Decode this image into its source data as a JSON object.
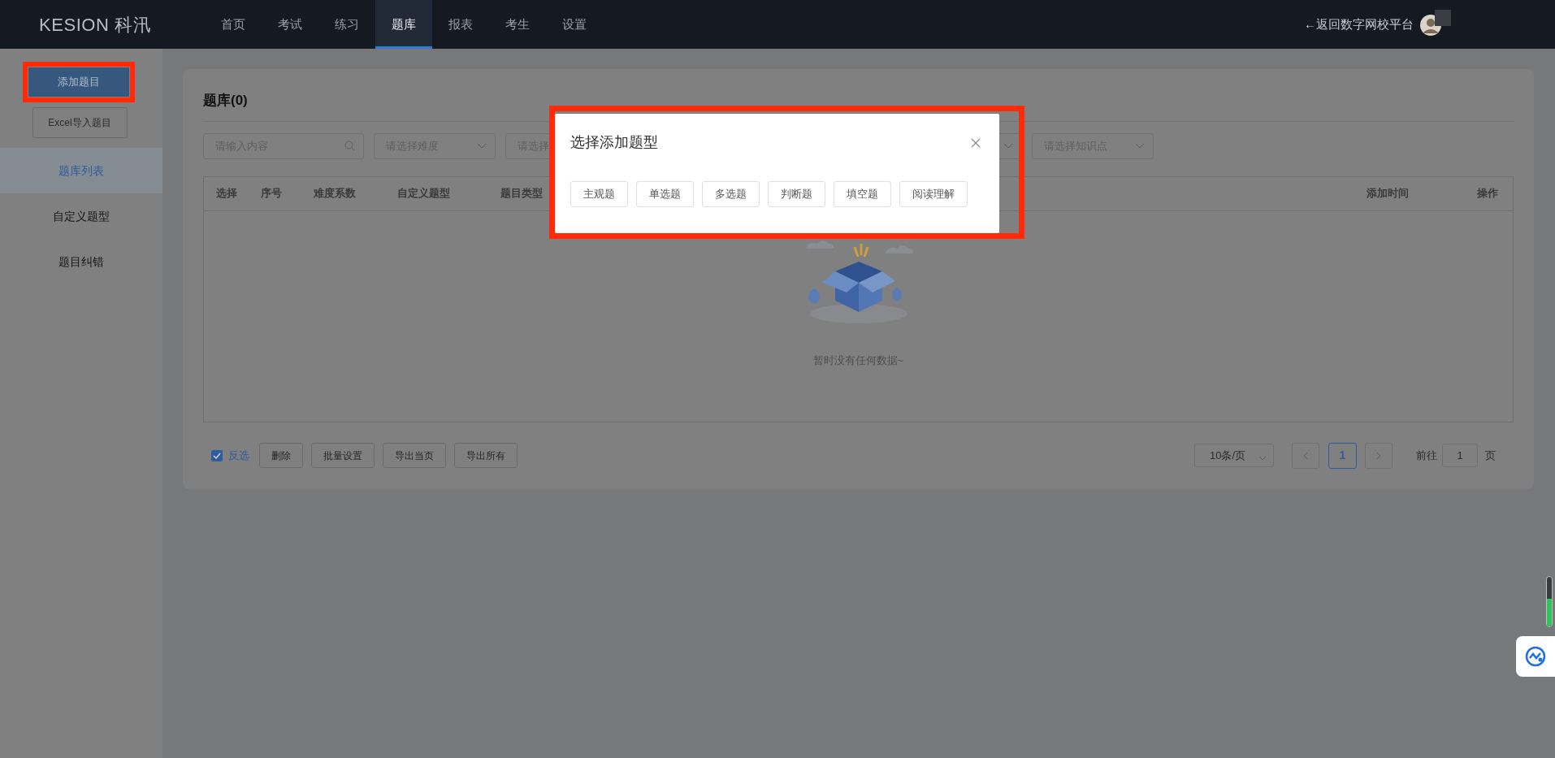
{
  "header": {
    "logo": "KESION 科汛",
    "nav": [
      {
        "label": "首页",
        "selected": false
      },
      {
        "label": "考试",
        "selected": false
      },
      {
        "label": "练习",
        "selected": false
      },
      {
        "label": "题库",
        "selected": true
      },
      {
        "label": "报表",
        "selected": false
      },
      {
        "label": "考生",
        "selected": false
      },
      {
        "label": "设置",
        "selected": false
      }
    ],
    "back_link": "←返回数字网校平台"
  },
  "sidebar": {
    "primary_button": "添加题目",
    "import_button": "Excel导入题目",
    "items": [
      {
        "label": "题库列表",
        "selected": true
      },
      {
        "label": "自定义题型",
        "selected": false
      },
      {
        "label": "题目纠错",
        "selected": false
      }
    ]
  },
  "panel": {
    "title": "题库(0)",
    "filters": [
      {
        "kind": "search",
        "placeholder": "请输入内容"
      },
      {
        "kind": "select",
        "placeholder": "请选择难度"
      },
      {
        "kind": "select",
        "placeholder": "请选择"
      },
      {
        "kind": "select"
      },
      {
        "kind": "select",
        "placeholder": "请选择知识点"
      }
    ],
    "table": {
      "columns": [
        "选择",
        "序号",
        "难度系数",
        "自定义题型",
        "题目类型",
        "添加时间",
        "操作"
      ],
      "empty_text": "暂时没有任何数据~"
    },
    "footer": {
      "invert_select": {
        "label": "反选",
        "checked": true
      },
      "actions": [
        "删除",
        "批量设置",
        "导出当页",
        "导出所有"
      ],
      "page_size": "10条/页",
      "pages": [
        {
          "label": "1",
          "selected": true
        }
      ],
      "goto_label": "前往",
      "goto_value": "1",
      "page_suffix": "页"
    }
  },
  "dialog": {
    "title": "选择添加题型",
    "options": [
      "主观题",
      "单选题",
      "多选题",
      "判断题",
      "填空题",
      "阅读理解"
    ]
  }
}
